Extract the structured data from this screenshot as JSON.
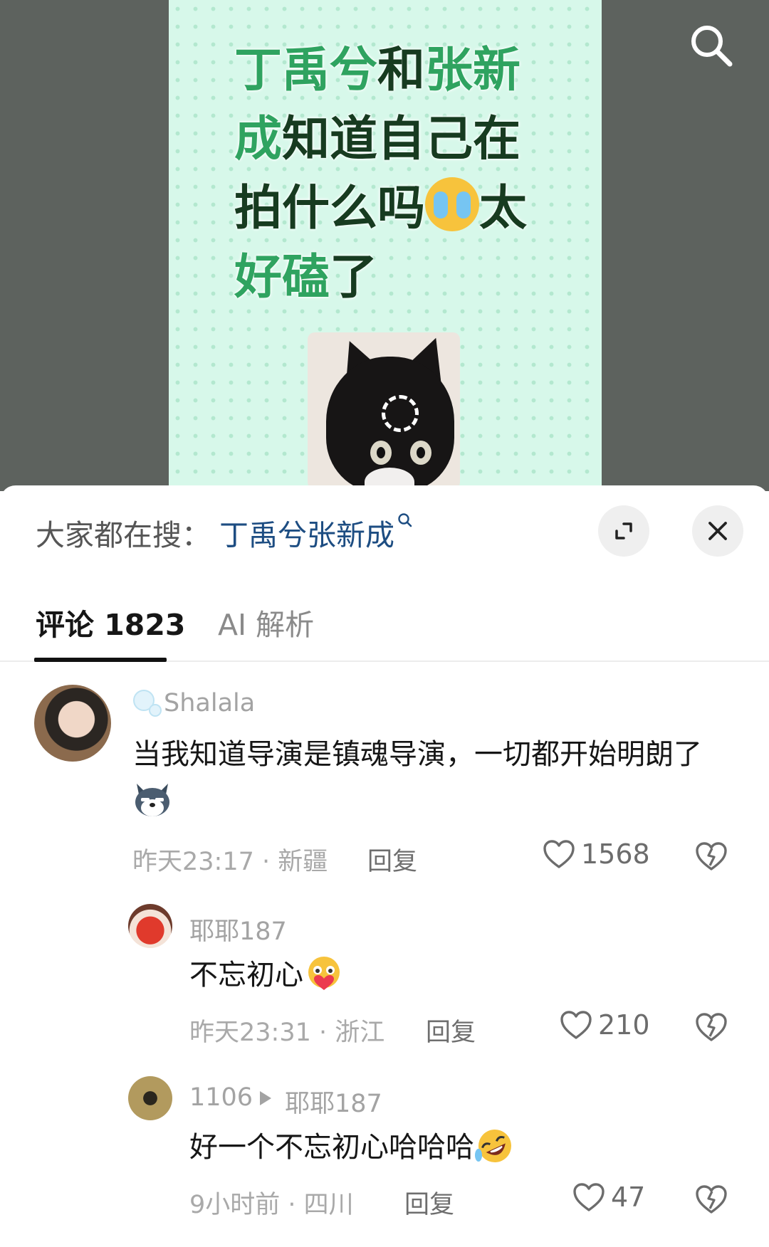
{
  "video": {
    "title_parts": [
      "丁禹兮",
      "和",
      "张新成",
      "知道自己在拍什么吗",
      "太",
      "好磕",
      "了"
    ]
  },
  "search_panel": {
    "prefix": "大家都在搜：",
    "term": "丁禹兮张新成",
    "term_icon": "search-small-icon"
  },
  "tabs": {
    "comments": "评论 1823",
    "ai": "AI 解析"
  },
  "comments": [
    {
      "user": "Shalala",
      "text": "当我知道导演是镇魂导演，一切都开始明朗了",
      "emoji": "wolf-emoji",
      "time_loc": "昨天23:17 · 新疆",
      "reply": "回复",
      "likes": "1568"
    },
    {
      "user": "耶耶187",
      "text": "不忘初心",
      "emoji": "hug-heart-emoji",
      "time_loc": "昨天23:31 · 浙江",
      "reply": "回复",
      "likes": "210"
    },
    {
      "user": "1106",
      "reply_to": "耶耶187",
      "text": "好一个不忘初心哈哈哈",
      "emoji": "rofl-emoji",
      "time_loc": "9小时前 · 四川",
      "reply": "回复",
      "likes": "47"
    }
  ],
  "colors": {
    "highlight_green": "#2fa360",
    "dark_green": "#173b20",
    "link_blue": "#1d4d82"
  }
}
